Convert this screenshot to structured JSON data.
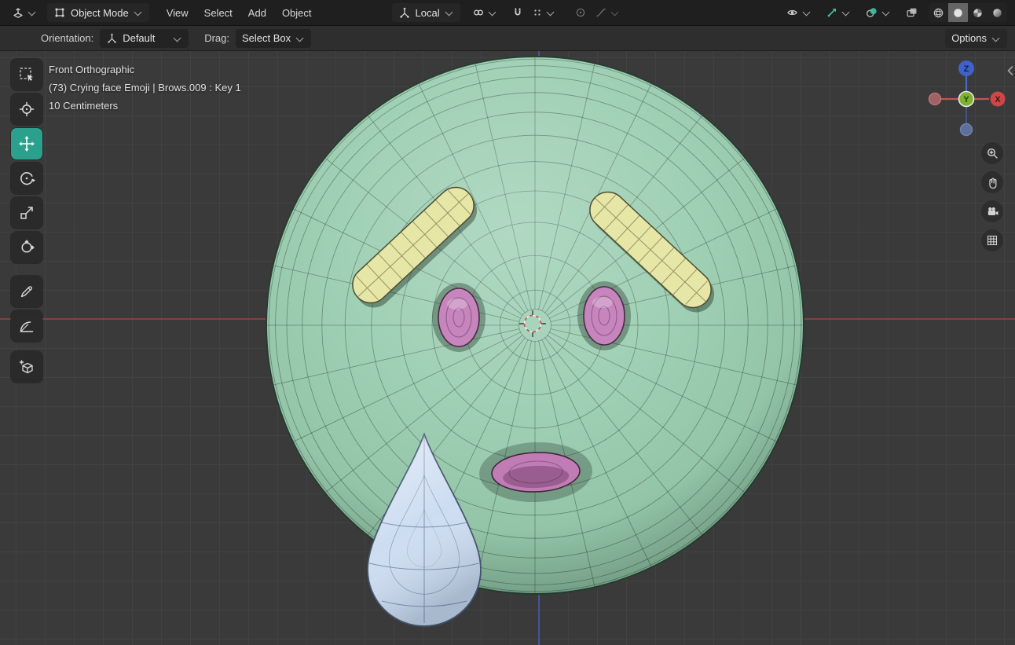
{
  "header": {
    "mode": "Object Mode",
    "menus": [
      "View",
      "Select",
      "Add",
      "Object"
    ],
    "transform_orientation": "Local",
    "active_shading": "solid"
  },
  "tool_settings": {
    "orientation_label": "Orientation:",
    "orientation_value": "Default",
    "drag_label": "Drag:",
    "drag_value": "Select Box",
    "options_label": "Options"
  },
  "toolbar": {
    "active_tool": "move"
  },
  "viewport_info": {
    "line1": "Front Orthographic",
    "line2": "(73) Crying face Emoji | Brows.009 : Key 1",
    "line3": "10 Centimeters"
  },
  "nav_gizmo": {
    "x_label": "X",
    "y_label": "Y",
    "z_label": "Z"
  },
  "colors": {
    "active_tool": "#2ba08d",
    "toggle_accent": "#3fbfa6",
    "axis_x_line": "#ab4343",
    "axis_z_line": "#4a63c8",
    "face_fill": "#9bceb1",
    "eye_fill": "#c685bc",
    "brow_fill": "#e6e6a6",
    "mouth_fill": "#bf7cb5",
    "tear_fill": "#cdddf1"
  },
  "icons": [
    "editor-3d-viewport-icon",
    "object-mode-icon",
    "orientation-axis-icon",
    "pivot-point-icon",
    "magnet-icon",
    "snap-settings-icon",
    "proportional-circle-icon",
    "falloff-curve-icon",
    "visibility-eye-icon",
    "gizmo-arrow-icon",
    "overlays-icon",
    "xray-icon",
    "wireframe-shading-icon",
    "solid-shading-icon",
    "material-shading-icon",
    "rendered-shading-icon",
    "select-box-icon",
    "cursor-icon",
    "move-icon",
    "rotate-icon",
    "scale-icon",
    "transform-icon",
    "annotate-icon",
    "measure-icon",
    "add-cube-icon",
    "zoom-icon",
    "pan-hand-icon",
    "camera-icon",
    "grid-icon",
    "chevron-down-icon",
    "chevron-left-icon"
  ]
}
